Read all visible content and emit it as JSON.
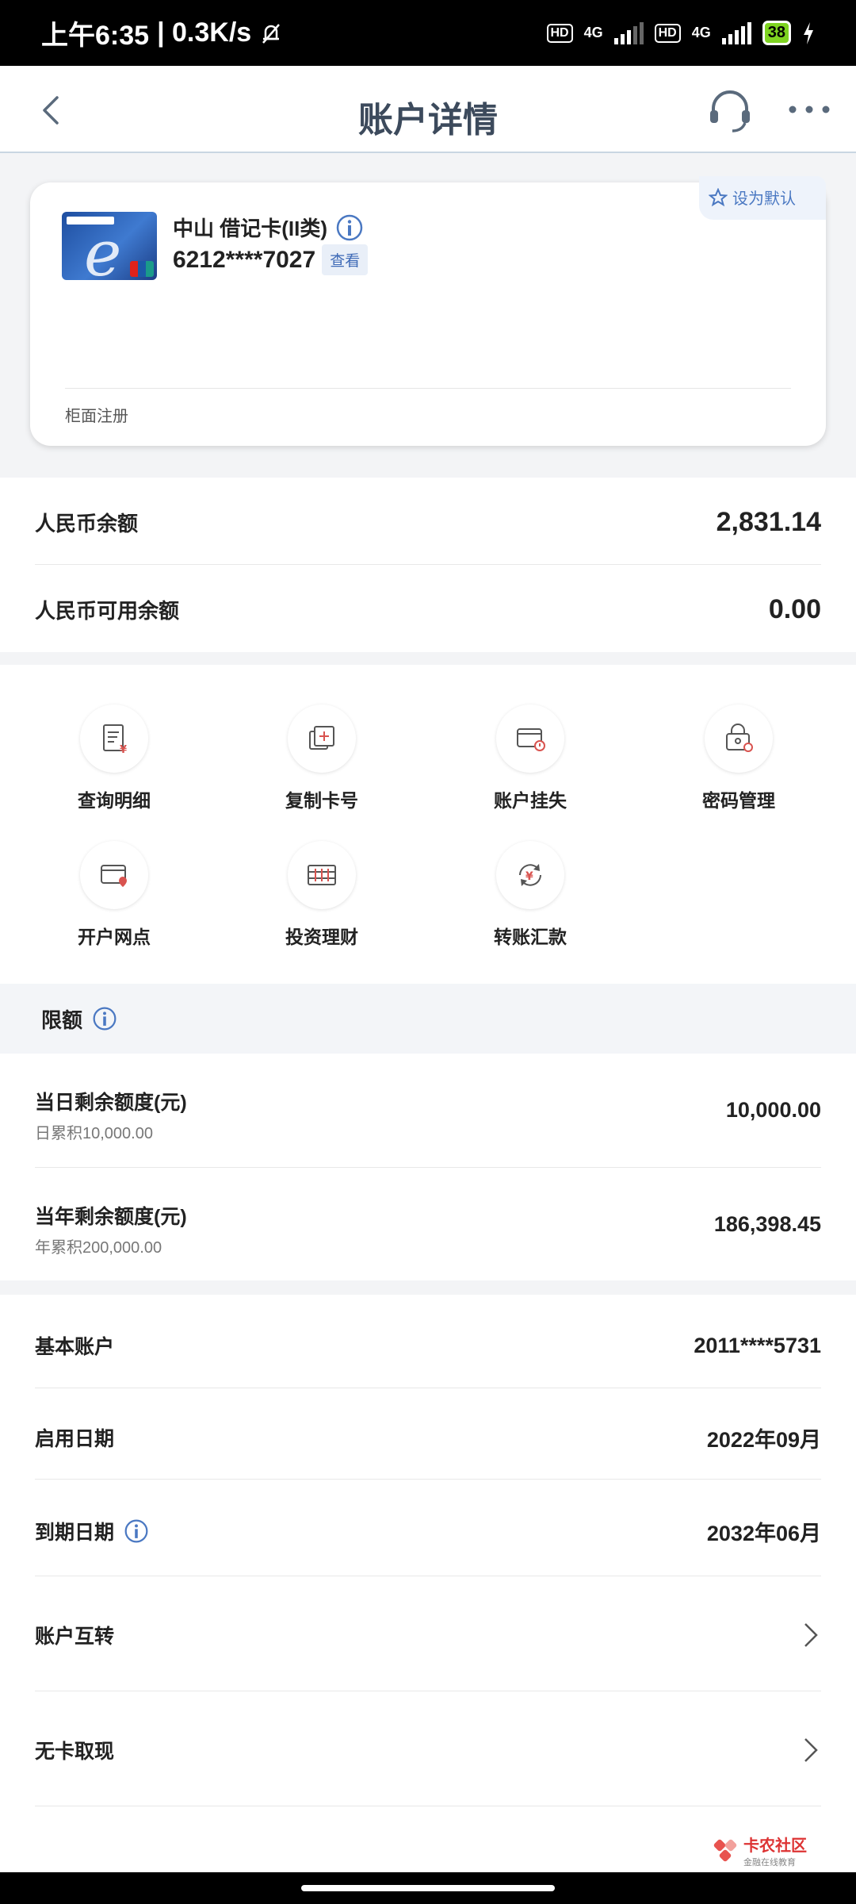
{
  "status_bar": {
    "time": "上午6:35",
    "speed": "| 0.3K/s",
    "hd1": "HD",
    "net1": "4G",
    "hd2": "HD",
    "net2": "4G",
    "battery": "38"
  },
  "header": {
    "title": "账户详情"
  },
  "card": {
    "set_default": "设为默认",
    "name": "中山 借记卡(II类)",
    "number": "6212****7027",
    "view": "查看",
    "registration": "柜面注册"
  },
  "balance": {
    "rmb_label": "人民币余额",
    "rmb_value": "2,831.14",
    "available_label": "人民币可用余额",
    "available_value": "0.00"
  },
  "actions": [
    {
      "label": "查询明细",
      "icon": "statement-icon"
    },
    {
      "label": "复制卡号",
      "icon": "copy-card-icon"
    },
    {
      "label": "账户挂失",
      "icon": "report-loss-icon"
    },
    {
      "label": "密码管理",
      "icon": "password-icon"
    },
    {
      "label": "开户网点",
      "icon": "branch-location-icon"
    },
    {
      "label": "投资理财",
      "icon": "investment-icon"
    },
    {
      "label": "转账汇款",
      "icon": "transfer-icon"
    }
  ],
  "limits": {
    "title": "限额",
    "daily_label": "当日剩余额度(元)",
    "daily_sub": "日累积10,000.00",
    "daily_value": "10,000.00",
    "yearly_label": "当年剩余额度(元)",
    "yearly_sub": "年累积200,000.00",
    "yearly_value": "186,398.45"
  },
  "details": {
    "basic_label": "基本账户",
    "basic_value": "2011****5731",
    "start_label": "启用日期",
    "start_value": "2022年09月",
    "expiry_label": "到期日期",
    "expiry_value": "2032年06月",
    "transfer_label": "账户互转",
    "cardless_label": "无卡取现"
  },
  "watermark": {
    "name": "卡农社区",
    "sub": "金融在线教育"
  },
  "colors": {
    "accent": "#4a78c2",
    "icon_red": "#d9534f"
  }
}
